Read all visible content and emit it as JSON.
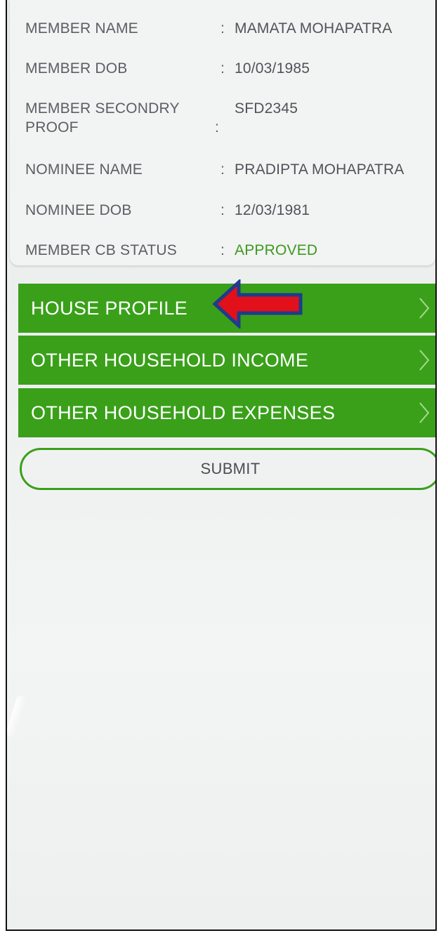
{
  "member_info": [
    {
      "label": "MEMBER NAME",
      "colon": ":",
      "value": "MAMATA MOHAPATRA"
    },
    {
      "label": "MEMBER DOB",
      "colon": ":",
      "value": "10/03/1985"
    },
    {
      "label": "MEMBER SECONDRY PROOF",
      "colon": ":",
      "value": "SFD2345"
    },
    {
      "label": "NOMINEE NAME",
      "colon": ":",
      "value": "PRADIPTA MOHAPATRA"
    },
    {
      "label": "NOMINEE DOB",
      "colon": ":",
      "value": "12/03/1981"
    },
    {
      "label": "MEMBER CB STATUS",
      "colon": ":",
      "value": "APPROVED"
    }
  ],
  "menu": [
    {
      "label": "HOUSE PROFILE",
      "icon": "chevron-right-icon"
    },
    {
      "label": "OTHER HOUSEHOLD INCOME",
      "icon": "chevron-right-icon"
    },
    {
      "label": "OTHER HOUSEHOLD EXPENSES",
      "icon": "chevron-right-icon"
    }
  ],
  "submit_label": "SUBMIT",
  "annotation": {
    "icon": "red-arrow-left-icon"
  },
  "colors": {
    "accent": "#3aa01a",
    "status_approved": "#3c9a1e",
    "annotation_arrow": "#e2101a",
    "annotation_outline": "#1f3b8c"
  }
}
